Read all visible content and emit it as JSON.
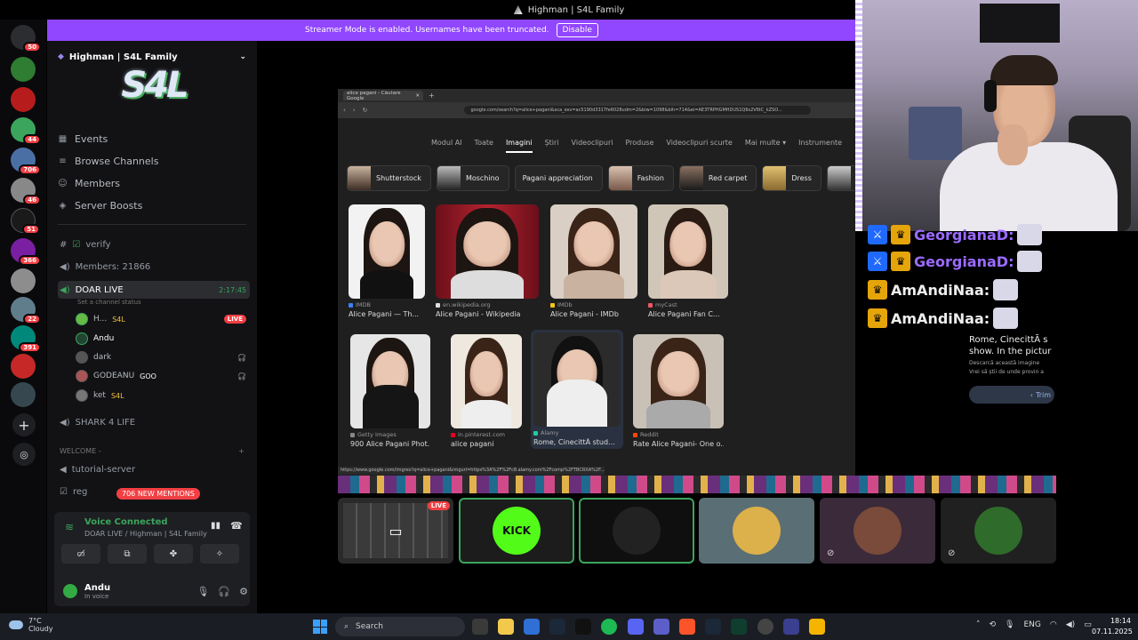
{
  "window": {
    "title": "Highman | S4L Family"
  },
  "streamer_bar": {
    "text": "Streamer Mode is enabled. Usernames have been truncated.",
    "button": "Disable"
  },
  "servers": [
    {
      "badge": "50",
      "color": "#5865f2"
    },
    {
      "badge": "",
      "color": "#2e7d32"
    },
    {
      "badge": "",
      "color": "#b71c1c"
    },
    {
      "badge": "44",
      "color": "#3ba55d"
    },
    {
      "badge": "706",
      "color": "#4a6fa5"
    },
    {
      "badge": "46",
      "color": "#888888"
    },
    {
      "badge": "51",
      "color": "#1a1a1a"
    },
    {
      "badge": "366",
      "color": "#7b1fa2"
    },
    {
      "badge": "",
      "color": "#8d8d8d"
    },
    {
      "badge": "22",
      "color": "#607d8b"
    },
    {
      "badge": "391",
      "color": "#00897b"
    },
    {
      "badge": "",
      "color": "#c62828"
    },
    {
      "badge": "",
      "color": "#37474f"
    }
  ],
  "sidebar": {
    "guild_name": "Highman | S4L Family",
    "banner_text": "S4L",
    "nav": [
      {
        "icon": "calendar-icon",
        "label": "Events"
      },
      {
        "icon": "browse-icon",
        "label": "Browse Channels"
      },
      {
        "icon": "members-icon",
        "label": "Members"
      },
      {
        "icon": "boost-icon",
        "label": "Server Boosts"
      }
    ],
    "channels": {
      "verify": "verify",
      "members": "Members: 21866",
      "doar_live": "DOAR LIVE",
      "doar_time": "2:17:45",
      "channel_status": "Set a channel status",
      "shark": "SHARK 4 LIFE",
      "welcome": "WELCOME -",
      "tutorial": "tutorial-server",
      "reg": "reg"
    },
    "voice_members": [
      {
        "name": "H...",
        "tag": "S4L",
        "live": "LIVE"
      },
      {
        "name": "Andu",
        "tag": "",
        "live": ""
      },
      {
        "name": "dark",
        "tag": "",
        "live": ""
      },
      {
        "name": "GODEANU",
        "tag": "GOO",
        "live": ""
      },
      {
        "name": "ket",
        "tag": "S4L",
        "live": ""
      }
    ],
    "mentions_badge": "706 NEW MENTIONS"
  },
  "voice_panel": {
    "status": "Voice Connected",
    "location": "DOAR LIVE / Highman | S4L Family"
  },
  "user": {
    "name": "Andu",
    "status": "In voice"
  },
  "browser": {
    "tab_title": "alice pagani - Căutare Google",
    "url": "google.com/search?q=alice+pagani&sca_esv=ac5190d3317fe6028udm=2&biw=1098&bih=714&ei=AE3TRPHGMHDUS1Q6s2V6tC_kZSO...",
    "status_url": "https://www.google.com/imgres?q=alice+pagani&imgurl=https%3A%2F%2Fc8.alamy.com%2Fcomp%2FTBCRXA%2F...",
    "search_tabs": [
      "Modul AI",
      "Toate",
      "Imagini",
      "Știri",
      "Videoclipuri",
      "Produse",
      "Videoclipuri scurte",
      "Mai multe ▾",
      "Instrumente"
    ],
    "chips": [
      "Shutterstock",
      "Moschino",
      "Pagani appreciation",
      "Fashion",
      "Red carpet",
      "Dress",
      "Mi"
    ],
    "results": [
      {
        "source": "IMDB",
        "title": "Alice Pagani — Th..."
      },
      {
        "source": "en.wikipedia.org",
        "title": "Alice Pagani - Wikipedia"
      },
      {
        "source": "IMDb",
        "title": "Alice Pagani - IMDb"
      },
      {
        "source": "myCast",
        "title": "Alice Pagani Fan C..."
      },
      {
        "source": "Getty Images",
        "title": "900 Alice Pagani Phot..."
      },
      {
        "source": "in.pinterest.com",
        "title": "alice pagani"
      },
      {
        "source": "Alamy",
        "title": "Rome, CinecittÃ stud..."
      },
      {
        "source": "Reddit",
        "title": "Rate Alice Pagani- One o..."
      }
    ]
  },
  "tiles": [
    {
      "label": "",
      "live": "LIVE"
    },
    {
      "label": "KICK",
      "live": ""
    },
    {
      "label": "",
      "live": ""
    },
    {
      "label": "",
      "live": ""
    },
    {
      "label": "",
      "live": ""
    },
    {
      "label": "",
      "live": ""
    }
  ],
  "chat": [
    {
      "user": "GeorgianaD:",
      "color": "#9b6bff"
    },
    {
      "user": "GeorgianaD:",
      "color": "#9b6bff"
    },
    {
      "user": "AmAndiNaa:",
      "color": "#e8e8e8"
    },
    {
      "user": "AmAndiNaa:",
      "color": "#e8e8e8"
    }
  ],
  "lens_card": {
    "text": "Rome, CinecittÃ s show. In the pictur",
    "sub1": "Descarcă această imagine",
    "sub2": "Vrei să știi de unde provin a",
    "button": "Trim"
  },
  "taskbar": {
    "temp": "7°C",
    "weather": "Cloudy",
    "search": "Search",
    "lang": "ENG",
    "time": "18:14",
    "date": "07.11.2025"
  }
}
